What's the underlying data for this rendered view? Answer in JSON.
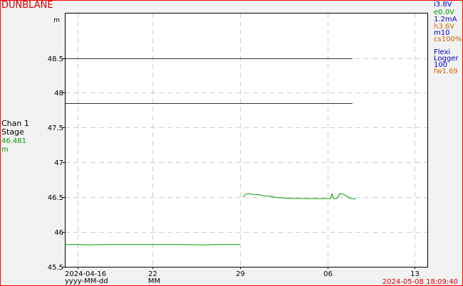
{
  "site_name": "DUNBLANE",
  "channel": {
    "name": "Chan 1",
    "parameter": "Stage",
    "value": "46.481",
    "unit": "m"
  },
  "status": [
    {
      "text": "i3.8V",
      "color": "#0000cc"
    },
    {
      "text": "e0.0V",
      "color": "#009a00"
    },
    {
      "text": "1.2mA",
      "color": "#0000cc"
    },
    {
      "text": "h3.6V",
      "color": "#cc6600"
    },
    {
      "text": "m10",
      "color": "#0000cc"
    },
    {
      "text": "cs100%",
      "color": "#cc6600"
    }
  ],
  "device": [
    {
      "text": "Flexi",
      "color": "#0000cc"
    },
    {
      "text": "Logger",
      "color": "#0000cc"
    },
    {
      "text": "100",
      "color": "#0000cc"
    },
    {
      "text": "fw1.69",
      "color": "#cc6600"
    }
  ],
  "timestamp": "2024-05-08 18:09:40",
  "colors": {
    "frame_border": "#ff0000",
    "plot_background": "#ffffff",
    "page_background": "#f2f2f2",
    "data_line": "#009a00",
    "threshold_line": "#333333",
    "grid": "#cccccc"
  },
  "chart_data": {
    "type": "line",
    "title": "",
    "ylabel": "m",
    "xlabel": "yyyy-MM-dd",
    "x_sublabel": "MM",
    "xlim": [
      "2024-04-15",
      "2024-05-14"
    ],
    "ylim": [
      45.5,
      49.15
    ],
    "grid": true,
    "y_ticks": [
      45.5,
      46,
      46.5,
      47,
      47.5,
      48,
      48.5
    ],
    "y_tick_labels": [
      "45.5",
      "46",
      "46.5",
      "47",
      "47.5",
      "48",
      "48.5"
    ],
    "x_ticks": [
      {
        "date": "2024-04-16",
        "label": "2024-04-16"
      },
      {
        "date": "2024-04-22",
        "label": "22"
      },
      {
        "date": "2024-04-29",
        "label": "29"
      },
      {
        "date": "2024-05-06",
        "label": "06"
      },
      {
        "date": "2024-05-13",
        "label": "13"
      }
    ],
    "thresholds": [
      {
        "y": 48.5,
        "start": "2024-04-15",
        "end": "2024-05-08"
      },
      {
        "y": 47.85,
        "start": "2024-04-15",
        "end": "2024-05-08"
      }
    ],
    "series": [
      {
        "segments": [
          [
            [
              "2024-04-15",
              45.82
            ],
            [
              "2024-04-16",
              45.82
            ],
            [
              "2024-04-17",
              45.815
            ],
            [
              "2024-04-18",
              45.82
            ],
            [
              "2024-04-20",
              45.82
            ],
            [
              "2024-04-22",
              45.82
            ],
            [
              "2024-04-24",
              45.82
            ],
            [
              "2024-04-26",
              45.815
            ],
            [
              "2024-04-27",
              45.82
            ],
            [
              "2024-04-28",
              45.82
            ],
            [
              "2024-04-29",
              45.82
            ]
          ],
          [
            [
              "2024-04-29T06:00",
              46.5
            ],
            [
              "2024-04-29T12:00",
              46.545
            ],
            [
              "2024-04-29T18:00",
              46.55
            ],
            [
              "2024-04-30",
              46.54
            ],
            [
              "2024-04-30T12:00",
              46.535
            ],
            [
              "2024-05-01",
              46.52
            ],
            [
              "2024-05-01T12:00",
              46.51
            ],
            [
              "2024-05-02",
              46.495
            ],
            [
              "2024-05-03",
              46.485
            ],
            [
              "2024-05-04",
              46.48
            ],
            [
              "2024-05-05",
              46.48
            ],
            [
              "2024-05-06",
              46.48
            ],
            [
              "2024-05-06T06:00",
              46.48
            ],
            [
              "2024-05-06T09:00",
              46.545
            ],
            [
              "2024-05-06T12:00",
              46.48
            ],
            [
              "2024-05-06T18:00",
              46.48
            ],
            [
              "2024-05-07",
              46.55
            ],
            [
              "2024-05-07T06:00",
              46.545
            ],
            [
              "2024-05-07T12:00",
              46.52
            ],
            [
              "2024-05-07T18:00",
              46.49
            ],
            [
              "2024-05-08",
              46.48
            ],
            [
              "2024-05-08T06:00",
              46.475
            ]
          ]
        ]
      }
    ]
  }
}
